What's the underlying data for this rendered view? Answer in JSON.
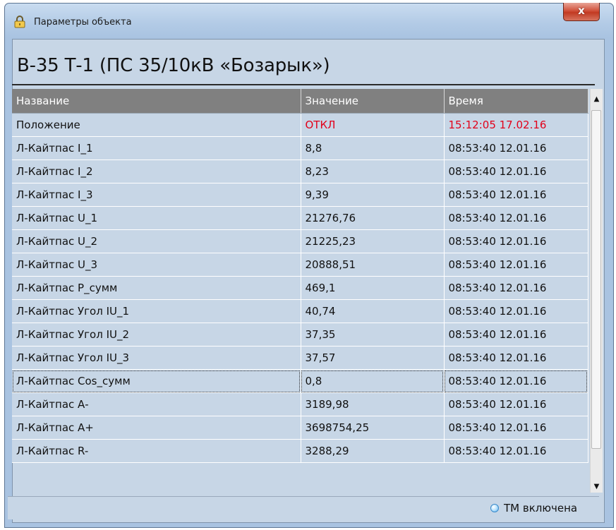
{
  "window": {
    "title": "Параметры объекта",
    "close_label": "x",
    "icon": "lock-icon"
  },
  "heading": "В-35 Т-1 (ПС 35/10кВ «Бозарык»)",
  "table": {
    "columns": [
      "Название",
      "Значение",
      "Время"
    ],
    "rows": [
      {
        "name": "Положение",
        "value": "ОТКЛ",
        "time": "15:12:05 17.02.16"
      },
      {
        "name": "Л-Кайтпас I_1",
        "value": "8,8",
        "time": "08:53:40 12.01.16"
      },
      {
        "name": "Л-Кайтпас I_2",
        "value": "8,23",
        "time": "08:53:40 12.01.16"
      },
      {
        "name": "Л-Кайтпас I_3",
        "value": "9,39",
        "time": "08:53:40 12.01.16"
      },
      {
        "name": "Л-Кайтпас U_1",
        "value": "21276,76",
        "time": "08:53:40 12.01.16"
      },
      {
        "name": "Л-Кайтпас U_2",
        "value": "21225,23",
        "time": "08:53:40 12.01.16"
      },
      {
        "name": "Л-Кайтпас U_3",
        "value": "20888,51",
        "time": "08:53:40 12.01.16"
      },
      {
        "name": "Л-Кайтпас P_сумм",
        "value": "469,1",
        "time": "08:53:40 12.01.16"
      },
      {
        "name": "Л-Кайтпас Угол IU_1",
        "value": "40,74",
        "time": "08:53:40 12.01.16"
      },
      {
        "name": "Л-Кайтпас Угол IU_2",
        "value": "37,35",
        "time": "08:53:40 12.01.16"
      },
      {
        "name": "Л-Кайтпас Угол IU_3",
        "value": "37,57",
        "time": "08:53:40 12.01.16"
      },
      {
        "name": "Л-Кайтпас Cos_сумм",
        "value": "0,8",
        "time": "08:53:40 12.01.16"
      },
      {
        "name": "Л-Кайтпас А-",
        "value": "3189,98",
        "time": "08:53:40 12.01.16"
      },
      {
        "name": "Л-Кайтпас А+",
        "value": "3698754,25",
        "time": "08:53:40 12.01.16"
      },
      {
        "name": "Л-Кайтпас R-",
        "value": "3288,29",
        "time": "08:53:40 12.01.16"
      }
    ]
  },
  "status": {
    "text": "ТМ включена",
    "indicator_color": "#5ab0ec"
  },
  "colors": {
    "alarm": "#e2001a",
    "header_bg": "#808080",
    "row_bg": "#c7d6e6"
  }
}
